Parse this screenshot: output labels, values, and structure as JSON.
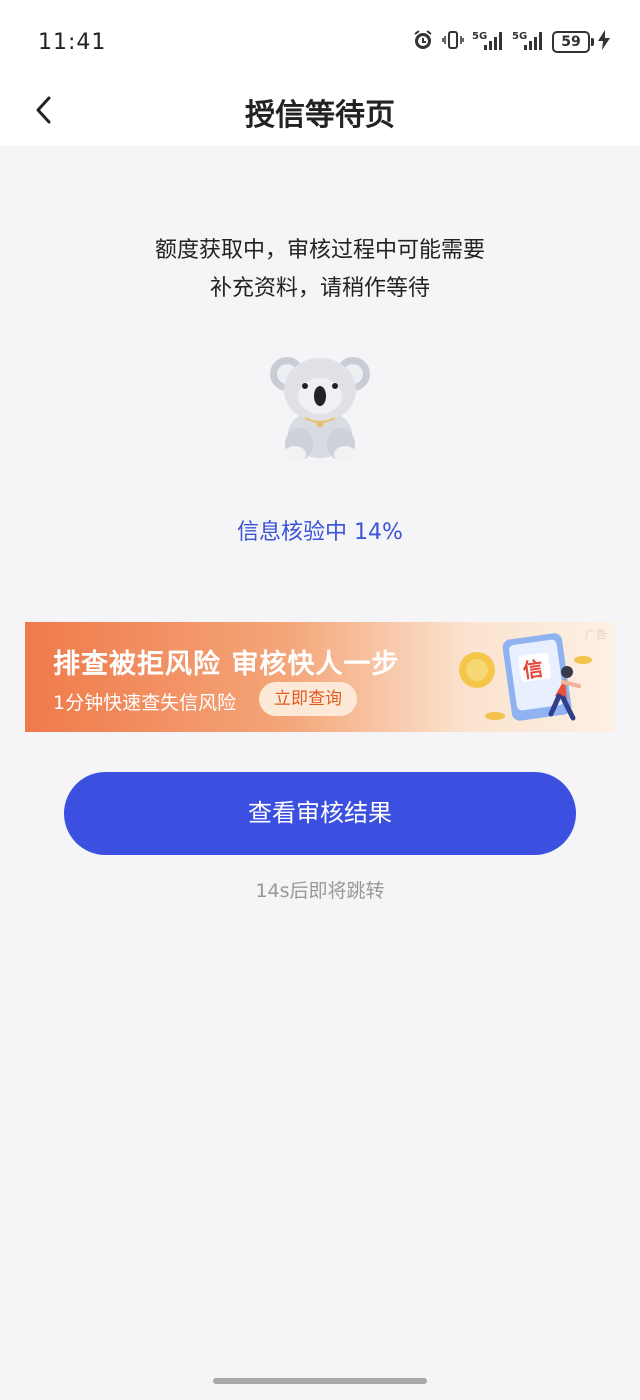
{
  "status_bar": {
    "time": "11:41",
    "battery": "59",
    "icons": [
      "alarm-icon",
      "vibrate-icon",
      "signal-5g-icon",
      "signal-5g-icon",
      "battery-icon",
      "charging-icon"
    ]
  },
  "header": {
    "title": "授信等待页",
    "back_icon": "chevron-left-icon"
  },
  "main": {
    "message_line1": "额度获取中，审核过程中可能需要",
    "message_line2": "补充资料，请稍作等待",
    "mascot": "koala-mascot",
    "progress_text": "信息核验中 14%"
  },
  "ad": {
    "title": "排查被拒风险  审核快人一步",
    "subtitle": "1分钟快速查失信风险",
    "button_label": "立即查询",
    "tag": "广告",
    "illustration_char": "信"
  },
  "actions": {
    "primary_label": "查看审核结果",
    "countdown": "14s后即将跳转"
  },
  "colors": {
    "accent": "#3b50e0",
    "progress": "#3b53d6",
    "background": "#f5f5f7"
  }
}
